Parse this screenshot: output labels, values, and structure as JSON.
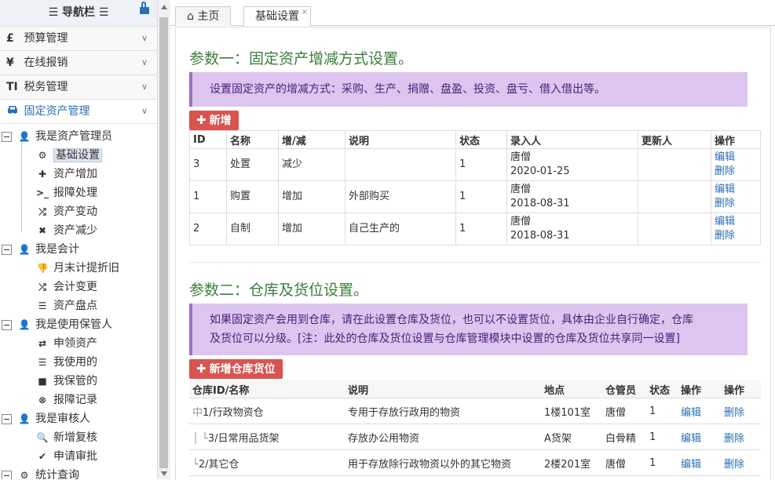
{
  "nav": {
    "title": "导航栏",
    "menus": [
      {
        "icon": "£",
        "label": "预算管理"
      },
      {
        "icon": "¥",
        "label": "在线报销"
      },
      {
        "icon": "TI",
        "label": "税务管理"
      },
      {
        "icon": "car",
        "label": "固定资产管理"
      }
    ],
    "groups": [
      {
        "label": "我是资产管理员",
        "items": [
          "基础设置",
          "资产增加",
          "报障处理",
          "资产变动",
          "资产减少"
        ]
      },
      {
        "label": "我是会计",
        "items": [
          "月末计提折旧",
          "会计变更",
          "资产盘点"
        ]
      },
      {
        "label": "我是使用保管人",
        "items": [
          "申领资产",
          "我使用的",
          "我保管的",
          "报障记录"
        ]
      },
      {
        "label": "我是审核人",
        "items": [
          "新增复核",
          "申请审批"
        ]
      },
      {
        "label": "统计查询",
        "items": []
      }
    ]
  },
  "tabs": [
    {
      "label": "主页"
    },
    {
      "label": "基础设置",
      "close": "×"
    }
  ],
  "section1": {
    "title": "参数一：固定资产增减方式设置。",
    "note": "设置固定资产的增减方式：采购、生产、捐赠、盘盈、投资、盘亏、借入借出等。",
    "add_button": "新增",
    "headers": [
      "ID",
      "名称",
      "增/减",
      "说明",
      "状态",
      "录入人",
      "更新人",
      "操作"
    ],
    "rows": [
      {
        "id": "3",
        "name": "处置",
        "type": "减少",
        "desc": "",
        "status": "1",
        "creator": "唐僧",
        "date": "2020-01-25",
        "updater": "",
        "edit": "编辑",
        "del": "删除"
      },
      {
        "id": "1",
        "name": "购置",
        "type": "增加",
        "desc": "外部购买",
        "status": "1",
        "creator": "唐僧",
        "date": "2018-08-31",
        "updater": "",
        "edit": "编辑",
        "del": "删除"
      },
      {
        "id": "2",
        "name": "自制",
        "type": "增加",
        "desc": "自己生产的",
        "status": "1",
        "creator": "唐僧",
        "date": "2018-08-31",
        "updater": "",
        "edit": "编辑",
        "del": "删除"
      }
    ]
  },
  "section2": {
    "title": "参数二：仓库及货位设置。",
    "note_line1": "如果固定资产会用到仓库，请在此设置仓库及货位，也可以不设置货位，具体由企业自行确定，仓库",
    "note_line2": "及货位可以分级。[注：此处的仓库及货位设置与仓库管理模块中设置的仓库及货位共享同一设置]",
    "add_button": "新增仓库货位",
    "headers": [
      "仓库ID/名称",
      "说明",
      "地点",
      "仓管员",
      "状态",
      "操作",
      "操作"
    ],
    "rows": [
      {
        "name": "1/行政物资仓",
        "prefix": "中",
        "desc": "专用于存放行政用的物资",
        "place": "1楼101室",
        "keeper": "唐僧",
        "status": "1",
        "edit": "编辑",
        "del": "删除"
      },
      {
        "name": "3/日常用品货架",
        "prefix": "│ └",
        "desc": "存放办公用物资",
        "place": "A货架",
        "keeper": "白骨精",
        "status": "1",
        "edit": "编辑",
        "del": "删除"
      },
      {
        "name": "2/其它仓",
        "prefix": "└",
        "desc": "用于存放除行政物资以外的其它物资",
        "place": "2楼201室",
        "keeper": "唐僧",
        "status": "1",
        "edit": "编辑",
        "del": "删除"
      }
    ]
  }
}
